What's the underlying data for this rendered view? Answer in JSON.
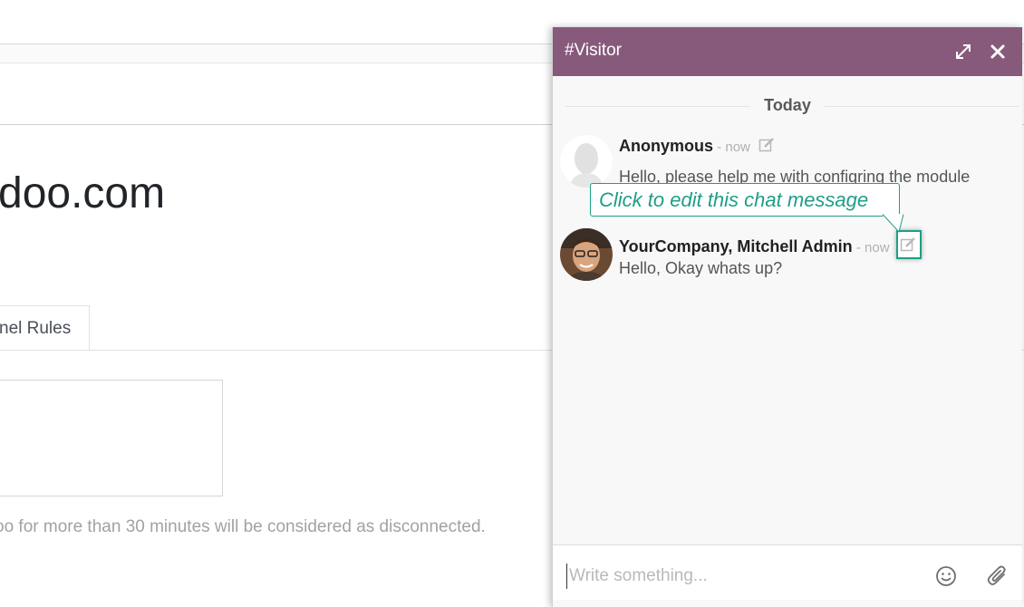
{
  "background": {
    "title": "doo.com",
    "tab_label": "nel Rules",
    "help_text": "oo for more than 30 minutes will be considered as disconnected."
  },
  "chat": {
    "title": "#Visitor",
    "day_separator": "Today",
    "messages": [
      {
        "author": "Anonymous",
        "meta": " - now",
        "body": "Hello, please help me with configring the module",
        "avatar": "default-avatar"
      },
      {
        "author": "YourCompany, Mitchell Admin",
        "meta": " - now",
        "body": "Hello, Okay whats up?",
        "avatar": "user-photo"
      }
    ],
    "tooltip": "Click to edit this chat message",
    "composer_placeholder": "Write something...",
    "colors": {
      "header": "#875a7b",
      "tooltip_accent": "#1e9e87"
    },
    "icons": [
      "expand-icon",
      "close-icon",
      "edit-icon",
      "emoji-icon",
      "paperclip-icon"
    ]
  }
}
